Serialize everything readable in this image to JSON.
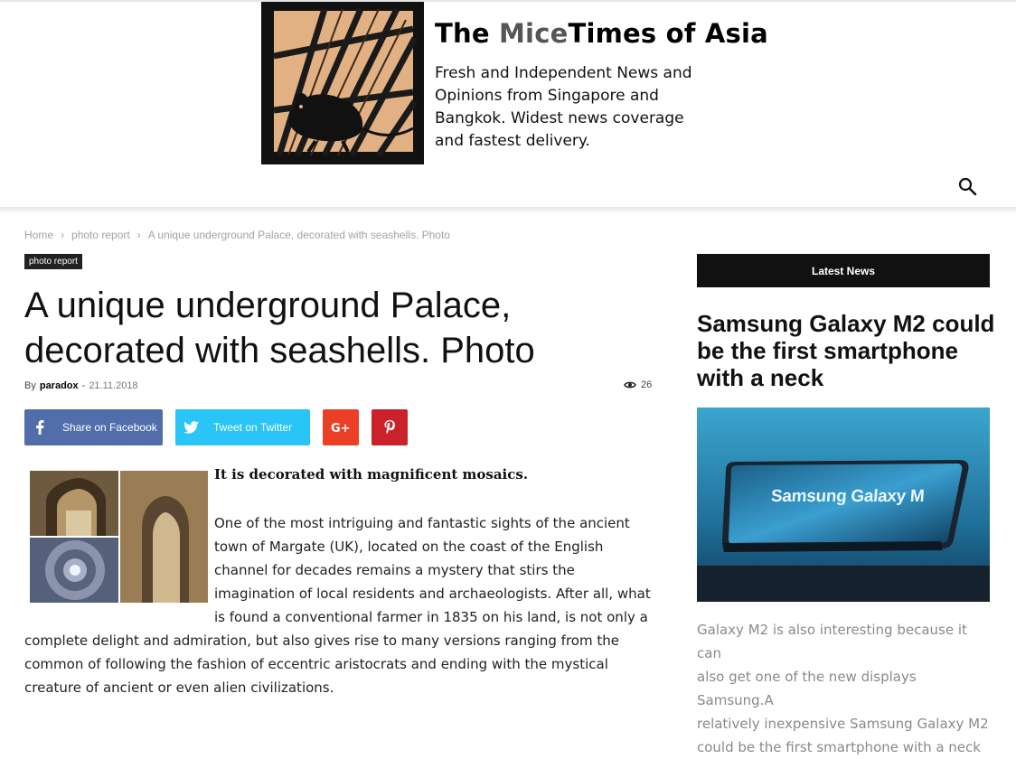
{
  "site": {
    "title_part1": "The ",
    "title_part2": "Mice",
    "title_part3": "Times of Asia",
    "tagline_lines": [
      "Fresh and Independent News and",
      "Opinions from Singapore and",
      "Bangkok. Widest news coverage",
      "and fastest delivery."
    ]
  },
  "icons": {
    "search": "search-icon",
    "eye": "eye-icon",
    "facebook": "facebook-icon",
    "twitter": "twitter-icon",
    "googleplus": "googleplus-icon",
    "pinterest": "pinterest-icon"
  },
  "breadcrumb": {
    "home": "Home",
    "separator": "›",
    "category": "photo report",
    "current": "A unique underground Palace, decorated with seashells. Photo"
  },
  "article": {
    "category_badge": "photo report",
    "title": "A unique underground Palace, decorated with seashells. Photo",
    "by_label": "By",
    "author": "paradox",
    "date_separator": "-",
    "date": "21.11.2018",
    "views": "26",
    "lead": "It is decorated with magnificent mosaics.",
    "para1_lines": [
      "One of the most intriguing and fantastic sights of the ancient",
      "town of Margate (UK), located on the coast of the English",
      "channel for decades remains a mystery that stirs the",
      "imagination of local residents and archaeologists. After all, what",
      "is found a conventional farmer in 1835 on his land, is not only a"
    ],
    "para2_lines": [
      "complete delight and admiration, but also gives rise to many versions ranging from the",
      "common of following the fashion of eccentric aristocrats and ending with the mystical",
      "creature of ancient or even alien civilizations."
    ]
  },
  "share": {
    "facebook": "Share on Facebook",
    "twitter": "Tweet on Twitter"
  },
  "sidebar": {
    "heading": "Latest News",
    "post_title": "Samsung Galaxy M2 could be the first smartphone with a neck",
    "image_caption": "Samsung Galaxy M",
    "excerpt_lines": [
      "Galaxy M2 is also interesting because it can",
      "also get one of the new displays Samsung.A",
      "relatively inexpensive Samsung Galaxy M2",
      "could be the first smartphone with a neck"
    ]
  },
  "colors": {
    "facebook": "#516eab",
    "twitter": "#29c5f6",
    "googleplus": "#eb4026",
    "pinterest": "#ca212a",
    "dark_bar": "#111111"
  }
}
